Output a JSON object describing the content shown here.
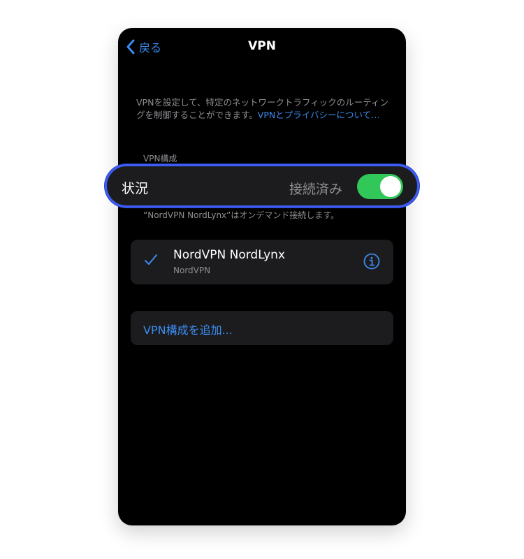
{
  "nav": {
    "back_label": "戻る",
    "title": "VPN"
  },
  "description": {
    "text": "VPNを設定して、特定のネットワークトラフィックのルーティングを制御することができます。",
    "link": "VPNとプライバシーについて…"
  },
  "section": {
    "label": "VPN構成"
  },
  "status": {
    "label": "状況",
    "value": "接続済み",
    "toggle_on": true,
    "toggle_color": "#32c759",
    "highlight_color": "#3d5df5"
  },
  "ondemand_note": "“NordVPN NordLynx”はオンデマンド接続します。",
  "vpn_config": {
    "name": "NordVPN NordLynx",
    "provider": "NordVPN",
    "selected": true,
    "check_icon": "checkmark-icon",
    "info_icon": "info-icon"
  },
  "add_config": {
    "label": "VPN構成を追加..."
  },
  "colors": {
    "accent": "#3b8cf0",
    "background": "#000000",
    "cell": "#1c1c1e",
    "secondary_text": "#8e8e93"
  }
}
